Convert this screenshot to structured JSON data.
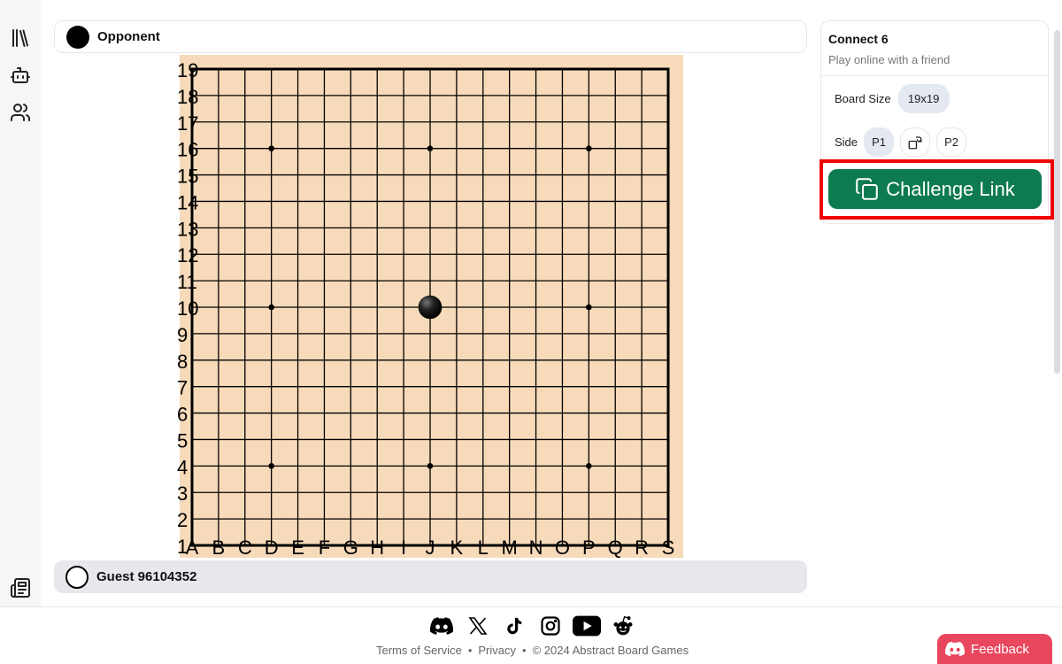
{
  "game": {
    "top_player": {
      "name": "Opponent",
      "stone": "black"
    },
    "bottom_player": {
      "name": "Guest 96104352",
      "stone": "white"
    },
    "board": {
      "size": 19,
      "columns": [
        "A",
        "B",
        "C",
        "D",
        "E",
        "F",
        "G",
        "H",
        "I",
        "J",
        "K",
        "L",
        "M",
        "N",
        "O",
        "P",
        "Q",
        "R",
        "S"
      ],
      "rows": [
        "19",
        "18",
        "17",
        "16",
        "15",
        "14",
        "13",
        "12",
        "11",
        "10",
        "9",
        "8",
        "7",
        "6",
        "5",
        "4",
        "3",
        "2",
        "1"
      ],
      "star_points": [
        "D16",
        "J16",
        "P16",
        "D10",
        "P10",
        "D4",
        "J4",
        "P4"
      ],
      "stones": [
        {
          "point": "J10",
          "color": "black"
        }
      ],
      "colors": {
        "background": "#f7dab9",
        "lines": "#000000"
      }
    }
  },
  "panel": {
    "title": "Connect 6",
    "subtitle": "Play online with a friend",
    "board_size_label": "Board Size",
    "board_size_value": "19x19",
    "side_label": "Side",
    "side_p1": "P1",
    "side_p2": "P2",
    "challenge_label": "Challenge Link",
    "accent_color": "#0d7a50"
  },
  "sidebar": {
    "icons": [
      "library-icon",
      "bot-icon",
      "users-icon",
      "news-icon"
    ]
  },
  "footer": {
    "socials": [
      "discord-icon",
      "x-icon",
      "tiktok-icon",
      "instagram-icon",
      "youtube-icon",
      "reddit-icon"
    ],
    "terms": "Terms of Service",
    "privacy": "Privacy",
    "copyright": "© 2024 Abstract Board Games",
    "separator": "•"
  },
  "feedback": {
    "label": "Feedback",
    "color": "#e8475d"
  }
}
